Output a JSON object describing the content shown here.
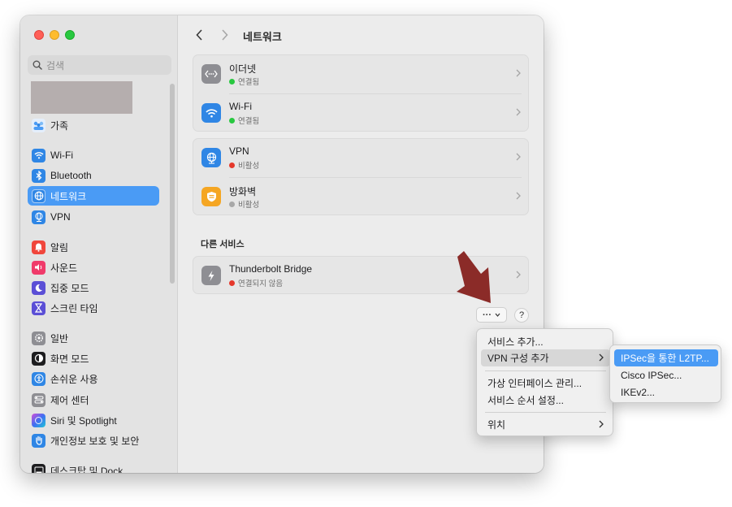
{
  "window": {
    "title": "네트워크"
  },
  "search": {
    "placeholder": "검색"
  },
  "sidebar": {
    "family": "가족",
    "items": [
      {
        "label": "Wi-Fi",
        "icon": "wifi-icon"
      },
      {
        "label": "Bluetooth",
        "icon": "bluetooth-icon"
      },
      {
        "label": "네트워크",
        "icon": "globe-icon",
        "selected": true
      },
      {
        "label": "VPN",
        "icon": "vpn-globe-icon"
      },
      {
        "label": "알림",
        "icon": "bell-icon"
      },
      {
        "label": "사운드",
        "icon": "speaker-icon"
      },
      {
        "label": "집중 모드",
        "icon": "moon-icon"
      },
      {
        "label": "스크린 타임",
        "icon": "hourglass-icon"
      },
      {
        "label": "일반",
        "icon": "gear-icon"
      },
      {
        "label": "화면 모드",
        "icon": "appearance-icon"
      },
      {
        "label": "손쉬운 사용",
        "icon": "accessibility-icon"
      },
      {
        "label": "제어 센터",
        "icon": "control-center-icon"
      },
      {
        "label": "Siri 및 Spotlight",
        "icon": "siri-icon"
      },
      {
        "label": "개인정보 보호 및 보안",
        "icon": "hand-icon"
      },
      {
        "label": "데스크탑 및 Dock",
        "icon": "dock-icon"
      }
    ]
  },
  "services": [
    {
      "name": "이더넷",
      "status": "연결됨",
      "status_color": "#28c840",
      "icon": "ethernet-icon"
    },
    {
      "name": "Wi-Fi",
      "status": "연결됨",
      "status_color": "#28c840",
      "icon": "wifi-icon"
    },
    {
      "name": "VPN",
      "status": "비활성",
      "status_color": "#e5382b",
      "icon": "vpn-globe-icon"
    },
    {
      "name": "방화벽",
      "status": "비활성",
      "status_color": "#a8a8a8",
      "icon": "firewall-icon"
    }
  ],
  "other": {
    "heading": "다른 서비스",
    "items": [
      {
        "name": "Thunderbolt Bridge",
        "status": "연결되지 않음",
        "status_color": "#e5382b",
        "icon": "thunderbolt-icon"
      }
    ]
  },
  "toolbar": {
    "more_label": "···",
    "help_label": "?"
  },
  "menu": {
    "items": [
      {
        "label": "서비스 추가..."
      },
      {
        "label": "VPN 구성 추가"
      },
      {
        "label": "가상 인터페이스 관리..."
      },
      {
        "label": "서비스 순서 설정..."
      },
      {
        "label": "위치"
      }
    ]
  },
  "submenu": {
    "items": [
      {
        "label": "IPSec을 통한 L2TP..."
      },
      {
        "label": "Cisco IPSec..."
      },
      {
        "label": "IKEv2..."
      }
    ]
  },
  "colors": {
    "accent": "#4a9bf5",
    "arrow": "#8b2b28"
  }
}
